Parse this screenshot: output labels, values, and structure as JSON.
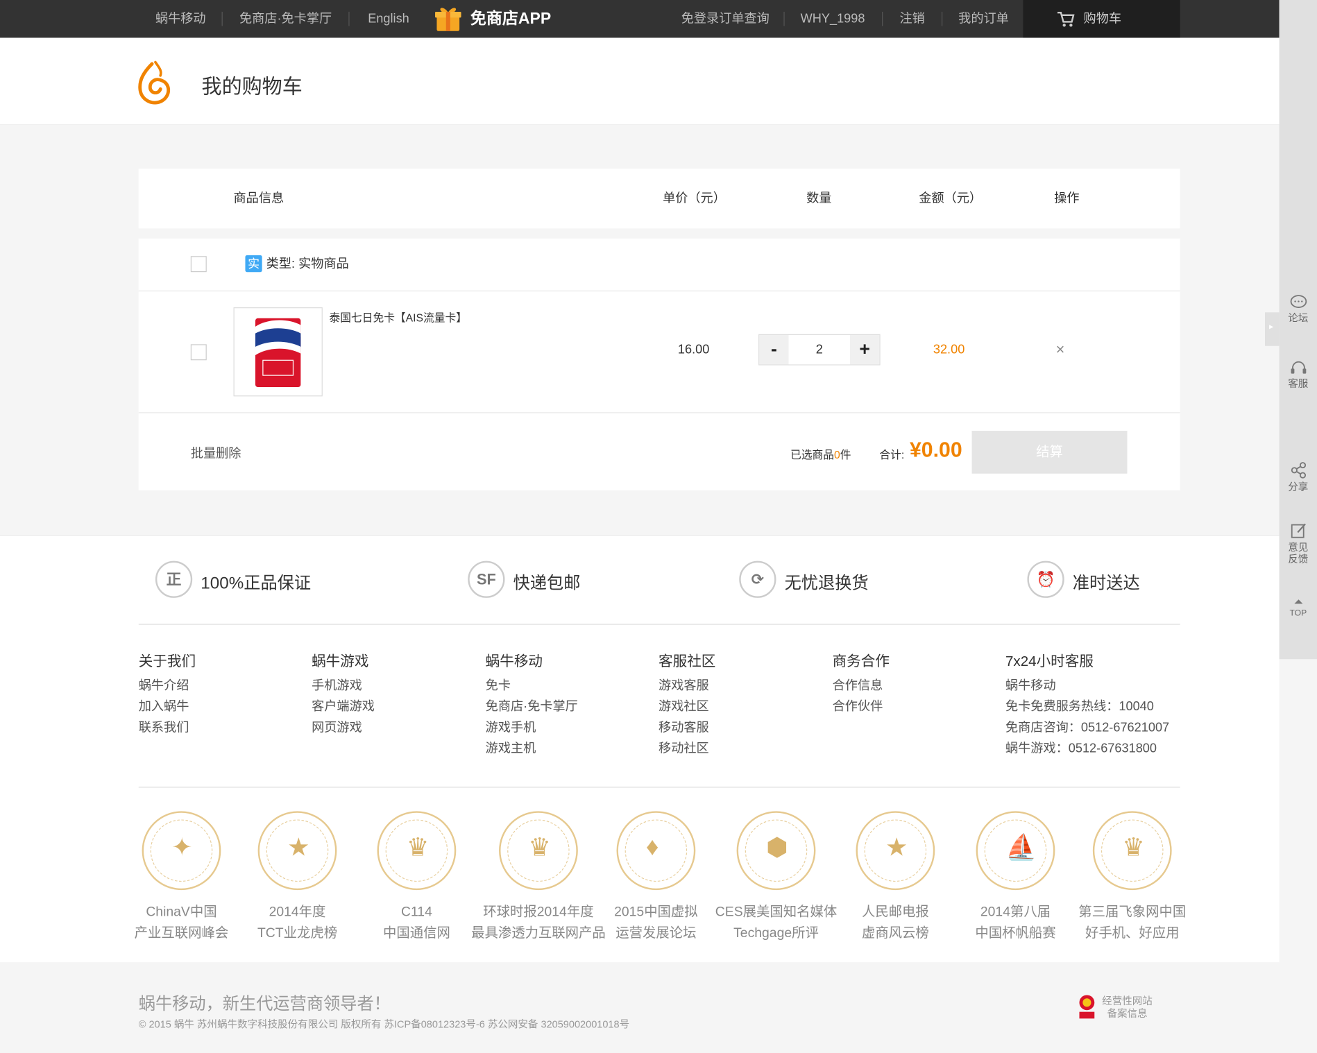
{
  "topbar": {
    "left_links": [
      "蜗牛移动",
      "免商店·免卡掌厅",
      "English"
    ],
    "app_label": "免商店APP",
    "right_links": [
      "免登录订单查询",
      "WHY_1998",
      "注销",
      "我的订单"
    ],
    "cart_label": "购物车"
  },
  "header": {
    "title": "我的购物车"
  },
  "table": {
    "headers": [
      "商品信息",
      "单价（元）",
      "数量",
      "金额（元）",
      "操作"
    ]
  },
  "group": {
    "type_badge": "实",
    "type_label": "类型:  实物商品"
  },
  "item": {
    "name": "泰国七日免卡【AIS流量卡】",
    "price": "16.00",
    "quantity": "2",
    "amount": "32.00",
    "remove": "×",
    "minus": "-",
    "plus": "+"
  },
  "summary": {
    "bulk_delete": "批量删除",
    "selected_prefix": "已选商品",
    "selected_count": "0",
    "selected_suffix": "件",
    "total_label": "合计:",
    "total_value": "¥0.00",
    "checkout": "结算"
  },
  "guarantees": [
    {
      "icon": "正",
      "label": "100%正品保证"
    },
    {
      "icon": "SF",
      "label": "快递包邮"
    },
    {
      "icon": "⟳",
      "label": "无忧退换货"
    },
    {
      "icon": "⏰",
      "label": "准时送达"
    }
  ],
  "footer_cols": [
    {
      "title": "关于我们",
      "links": [
        "蜗牛介绍",
        "加入蜗牛",
        "联系我们"
      ]
    },
    {
      "title": "蜗牛游戏",
      "links": [
        "手机游戏",
        "客户端游戏",
        "网页游戏"
      ]
    },
    {
      "title": "蜗牛移动",
      "links": [
        "免卡",
        "免商店·免卡掌厅",
        "游戏手机",
        "游戏主机"
      ]
    },
    {
      "title": "客服社区",
      "links": [
        "游戏客服",
        "游戏社区",
        "移动客服",
        "移动社区"
      ]
    },
    {
      "title": "商务合作",
      "links": [
        "合作信息",
        "合作伙伴"
      ]
    },
    {
      "title": "7x24小时客服",
      "links": [
        "蜗牛移动",
        "免卡免费服务热线：10040",
        "免商店咨询：0512-67621007",
        "蜗牛游戏：0512-67631800"
      ]
    }
  ],
  "awards": [
    {
      "line1": "ChinaV中国",
      "line2": "产业互联网峰会"
    },
    {
      "line1": "2014年度",
      "line2": "TCT业龙虎榜"
    },
    {
      "line1": "C114",
      "line2": "中国通信网"
    },
    {
      "line1": "环球时报2014年度",
      "line2": "最具渗透力互联网产品"
    },
    {
      "line1": "2015中国虚拟",
      "line2": "运营发展论坛"
    },
    {
      "line1": "CES展美国知名媒体",
      "line2": "Techgage所评"
    },
    {
      "line1": "人民邮电报",
      "line2": "虚商风云榜"
    },
    {
      "line1": "2014第八届",
      "line2": "中国杯帆船赛"
    },
    {
      "line1": "第三届飞象网中国",
      "line2": "好手机、好应用"
    }
  ],
  "bottom": {
    "slogan": "蜗牛移动，新生代运营商领导者！",
    "copyright": "© 2015 蜗牛 苏州蜗牛数字科技股份有限公司 版权所有 苏ICP备08012323号-6 苏公网安备 32059002001018号",
    "license_line1": "经营性网站",
    "license_line2": "备案信息"
  },
  "sidebar": {
    "items": [
      "论坛",
      "客服",
      "分享",
      "意见反馈",
      "TOP"
    ]
  },
  "colors": {
    "accent": "#f08300",
    "topbar": "#333333",
    "badge": "#3fa9f5"
  }
}
